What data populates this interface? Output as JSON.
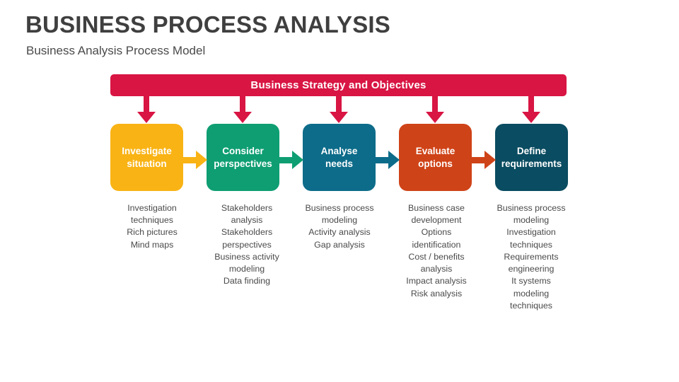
{
  "header": {
    "title": "BUSINESS PROCESS ANALYSIS",
    "subtitle": "Business Analysis Process Model"
  },
  "banner": {
    "label": "Business Strategy and Objectives",
    "color": "#d81543"
  },
  "colors": {
    "crimson": "#d81543",
    "amber": "#f9b315",
    "green": "#0e9e72",
    "teal": "#0d6c8a",
    "orange": "#cf4318",
    "dark_teal": "#0a4c61",
    "text": "#4a4a4a",
    "title": "#3f3f3f",
    "background": "#ffffff"
  },
  "steps": [
    {
      "label": "Investigate\nsituation",
      "color": "#f9b315",
      "details": "Investigation techniques\nRich pictures\nMind maps"
    },
    {
      "label": "Consider\nperspectives",
      "color": "#0e9e72",
      "details": "Stakeholders analysis\nStakeholders perspectives\nBusiness activity modeling\nData finding"
    },
    {
      "label": "Analyse\nneeds",
      "color": "#0d6c8a",
      "details": "Business process modeling\nActivity analysis\nGap analysis"
    },
    {
      "label": "Evaluate\noptions",
      "color": "#cf4318",
      "details": "Business case development\nOptions identification\nCost / benefits analysis\nImpact analysis\nRisk analysis"
    },
    {
      "label": "Define\nrequirements",
      "color": "#0a4c61",
      "details": "Business process modeling\nInvestigation techniques\nRequirements engineering\nIt systems modeling techniques"
    }
  ]
}
